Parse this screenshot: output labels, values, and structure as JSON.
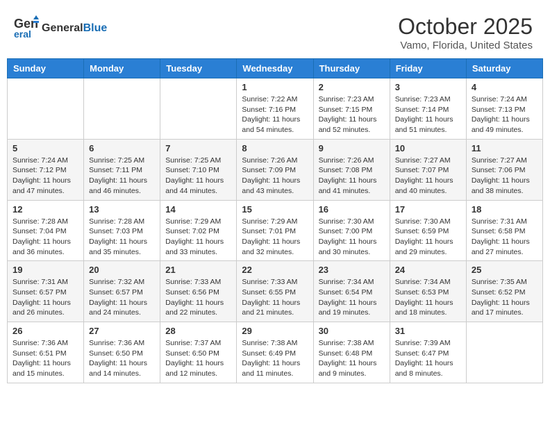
{
  "header": {
    "logo_general": "General",
    "logo_blue": "Blue",
    "month_title": "October 2025",
    "location": "Vamo, Florida, United States"
  },
  "days_of_week": [
    "Sunday",
    "Monday",
    "Tuesday",
    "Wednesday",
    "Thursday",
    "Friday",
    "Saturday"
  ],
  "weeks": [
    [
      {
        "day": "",
        "info": ""
      },
      {
        "day": "",
        "info": ""
      },
      {
        "day": "",
        "info": ""
      },
      {
        "day": "1",
        "info": "Sunrise: 7:22 AM\nSunset: 7:16 PM\nDaylight: 11 hours\nand 54 minutes."
      },
      {
        "day": "2",
        "info": "Sunrise: 7:23 AM\nSunset: 7:15 PM\nDaylight: 11 hours\nand 52 minutes."
      },
      {
        "day": "3",
        "info": "Sunrise: 7:23 AM\nSunset: 7:14 PM\nDaylight: 11 hours\nand 51 minutes."
      },
      {
        "day": "4",
        "info": "Sunrise: 7:24 AM\nSunset: 7:13 PM\nDaylight: 11 hours\nand 49 minutes."
      }
    ],
    [
      {
        "day": "5",
        "info": "Sunrise: 7:24 AM\nSunset: 7:12 PM\nDaylight: 11 hours\nand 47 minutes."
      },
      {
        "day": "6",
        "info": "Sunrise: 7:25 AM\nSunset: 7:11 PM\nDaylight: 11 hours\nand 46 minutes."
      },
      {
        "day": "7",
        "info": "Sunrise: 7:25 AM\nSunset: 7:10 PM\nDaylight: 11 hours\nand 44 minutes."
      },
      {
        "day": "8",
        "info": "Sunrise: 7:26 AM\nSunset: 7:09 PM\nDaylight: 11 hours\nand 43 minutes."
      },
      {
        "day": "9",
        "info": "Sunrise: 7:26 AM\nSunset: 7:08 PM\nDaylight: 11 hours\nand 41 minutes."
      },
      {
        "day": "10",
        "info": "Sunrise: 7:27 AM\nSunset: 7:07 PM\nDaylight: 11 hours\nand 40 minutes."
      },
      {
        "day": "11",
        "info": "Sunrise: 7:27 AM\nSunset: 7:06 PM\nDaylight: 11 hours\nand 38 minutes."
      }
    ],
    [
      {
        "day": "12",
        "info": "Sunrise: 7:28 AM\nSunset: 7:04 PM\nDaylight: 11 hours\nand 36 minutes."
      },
      {
        "day": "13",
        "info": "Sunrise: 7:28 AM\nSunset: 7:03 PM\nDaylight: 11 hours\nand 35 minutes."
      },
      {
        "day": "14",
        "info": "Sunrise: 7:29 AM\nSunset: 7:02 PM\nDaylight: 11 hours\nand 33 minutes."
      },
      {
        "day": "15",
        "info": "Sunrise: 7:29 AM\nSunset: 7:01 PM\nDaylight: 11 hours\nand 32 minutes."
      },
      {
        "day": "16",
        "info": "Sunrise: 7:30 AM\nSunset: 7:00 PM\nDaylight: 11 hours\nand 30 minutes."
      },
      {
        "day": "17",
        "info": "Sunrise: 7:30 AM\nSunset: 6:59 PM\nDaylight: 11 hours\nand 29 minutes."
      },
      {
        "day": "18",
        "info": "Sunrise: 7:31 AM\nSunset: 6:58 PM\nDaylight: 11 hours\nand 27 minutes."
      }
    ],
    [
      {
        "day": "19",
        "info": "Sunrise: 7:31 AM\nSunset: 6:57 PM\nDaylight: 11 hours\nand 26 minutes."
      },
      {
        "day": "20",
        "info": "Sunrise: 7:32 AM\nSunset: 6:57 PM\nDaylight: 11 hours\nand 24 minutes."
      },
      {
        "day": "21",
        "info": "Sunrise: 7:33 AM\nSunset: 6:56 PM\nDaylight: 11 hours\nand 22 minutes."
      },
      {
        "day": "22",
        "info": "Sunrise: 7:33 AM\nSunset: 6:55 PM\nDaylight: 11 hours\nand 21 minutes."
      },
      {
        "day": "23",
        "info": "Sunrise: 7:34 AM\nSunset: 6:54 PM\nDaylight: 11 hours\nand 19 minutes."
      },
      {
        "day": "24",
        "info": "Sunrise: 7:34 AM\nSunset: 6:53 PM\nDaylight: 11 hours\nand 18 minutes."
      },
      {
        "day": "25",
        "info": "Sunrise: 7:35 AM\nSunset: 6:52 PM\nDaylight: 11 hours\nand 17 minutes."
      }
    ],
    [
      {
        "day": "26",
        "info": "Sunrise: 7:36 AM\nSunset: 6:51 PM\nDaylight: 11 hours\nand 15 minutes."
      },
      {
        "day": "27",
        "info": "Sunrise: 7:36 AM\nSunset: 6:50 PM\nDaylight: 11 hours\nand 14 minutes."
      },
      {
        "day": "28",
        "info": "Sunrise: 7:37 AM\nSunset: 6:50 PM\nDaylight: 11 hours\nand 12 minutes."
      },
      {
        "day": "29",
        "info": "Sunrise: 7:38 AM\nSunset: 6:49 PM\nDaylight: 11 hours\nand 11 minutes."
      },
      {
        "day": "30",
        "info": "Sunrise: 7:38 AM\nSunset: 6:48 PM\nDaylight: 11 hours\nand 9 minutes."
      },
      {
        "day": "31",
        "info": "Sunrise: 7:39 AM\nSunset: 6:47 PM\nDaylight: 11 hours\nand 8 minutes."
      },
      {
        "day": "",
        "info": ""
      }
    ]
  ]
}
